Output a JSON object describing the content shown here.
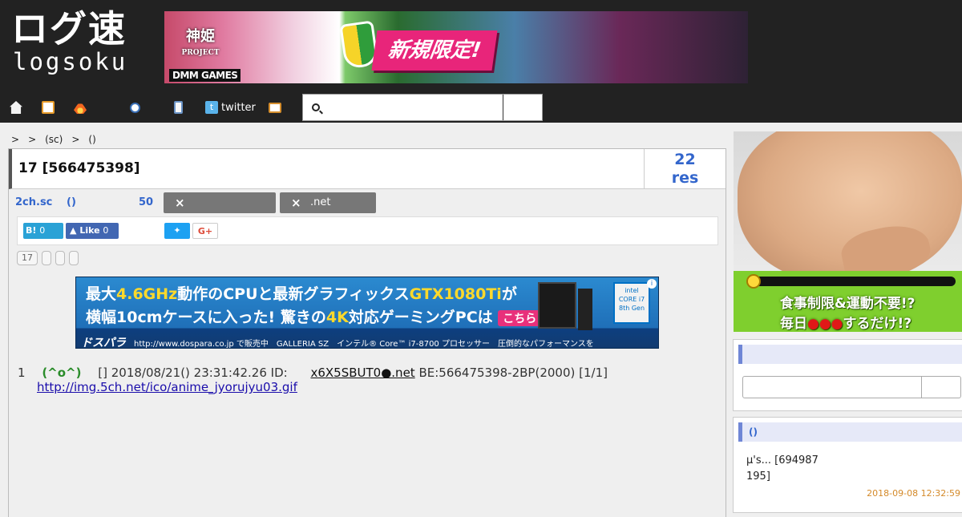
{
  "header": {
    "logo_jp": "ログ速",
    "logo_en": "logsoku",
    "top_banner": {
      "kami": "神姫",
      "kami_sub": "PROJECT",
      "promo": "新規限定!",
      "maker": "DMM GAMES"
    },
    "nav": {
      "home_icon": "home-icon",
      "tv_icon": "tv-icon",
      "fire_icon": "fire-icon",
      "search_icon": "search-icon",
      "doc_icon": "document-icon",
      "twitter_label": "twitter",
      "mail_icon": "mail-icon"
    },
    "search": {
      "placeholder": "",
      "value": ""
    }
  },
  "breadcrumb": [
    ">",
    ">",
    "(sc)",
    ">",
    "()"
  ],
  "thread": {
    "title": "17 [566475398]",
    "res_count": "22",
    "res_label": "res",
    "board": "2ch.sc",
    "paren": "()",
    "count": "50",
    "tag1_x": "×",
    "tag1": "",
    "tag2_x": "×",
    "tag2": ".net"
  },
  "share": {
    "hatena_label": "B!",
    "hatena_count": "0",
    "like_label": "Like",
    "like_count": "0",
    "twitter_icon": "twitter-icon",
    "gplus_label": "G+"
  },
  "mini_buttons": [
    "17",
    "",
    "",
    ""
  ],
  "mid_banner": {
    "line1_a": "最大",
    "line1_b": "4.6GHz",
    "line1_c": "動作のCPUと最新グラフィックス",
    "line1_d": "GTX1080Ti",
    "line1_e": "が",
    "line2_a": "横幅10cmケースに入った! 驚きの",
    "line2_b": "4K",
    "line2_c": "対応ゲーミングPCは",
    "line2_cta": "こちら",
    "brand": "ドスパラ",
    "line3": "http://www.dospara.co.jp で販売中　GALLERIA SZ　インテル® Core™ i7-8700 プロセッサー　圧倒的なパフォーマンスを",
    "intel": "intel CORE i7 8th Gen"
  },
  "post": {
    "number": "1",
    "name": "(^o^)",
    "info": "[] 2018/08/21() 23:31:42.26 ID:",
    "id": "x6X5SBUT0●.net",
    "be": "BE:566475398-2BP(2000) [1/1]",
    "link": "http://img.5ch.net/ico/anime_jyorujyu03.gif"
  },
  "sidebar": {
    "ad_line1": "食事制限&運動不要!?",
    "ad_line2a": "毎日",
    "ad_line2b": "●●●",
    "ad_line2c": "するだけ!?",
    "search_title": "",
    "list_title": "()",
    "item_text": "µ's... [694987 195]",
    "item_time": "2018-09-08 12:32:59"
  }
}
